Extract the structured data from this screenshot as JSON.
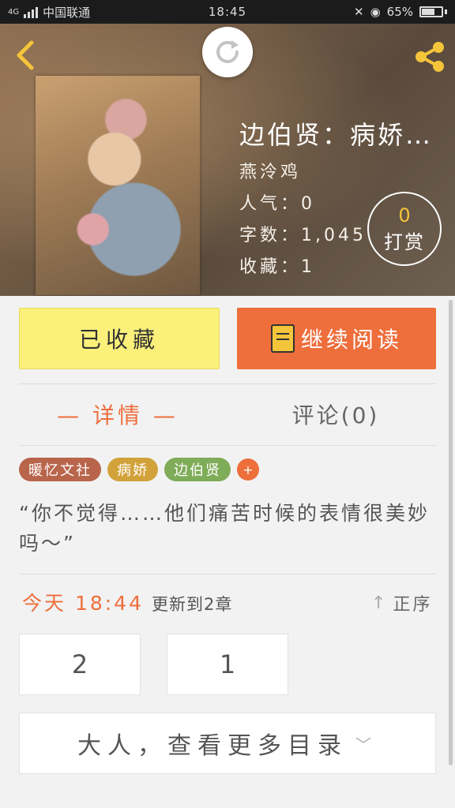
{
  "status_bar": {
    "network": "4G",
    "carrier": "中国联通",
    "time": "18:45",
    "battery": "65%"
  },
  "header": {
    "back_icon": "chevron-left-icon",
    "refresh_icon": "refresh-icon",
    "share_icon": "share-icon"
  },
  "book": {
    "title": "边伯贤：病娇…",
    "author": "燕泠鸡",
    "popularity": "人气：0",
    "word_count": "字数：1,045",
    "collections": "收藏：1",
    "tip_count": "0",
    "tip_label": "打赏"
  },
  "actions": {
    "collected_label": "已收藏",
    "continue_label": "继续阅读"
  },
  "tabs": {
    "detail": "— 详情 —",
    "comments": "评论(0)"
  },
  "tags": [
    "暖忆文社",
    "病娇",
    "边伯贤"
  ],
  "tag_add": "+",
  "blurb": "“你不觉得……他们痛苦时候的表情很美妙吗～”",
  "update": {
    "time": "今天 18:44",
    "text": "更新到2章",
    "sort_label": "正序"
  },
  "chapters": [
    "2",
    "1"
  ],
  "more_toc": "大人，查看更多目录",
  "colors": {
    "accent": "#ee6e3c",
    "collected_bg": "#faf07a",
    "tip_gold": "#f4c43a"
  }
}
